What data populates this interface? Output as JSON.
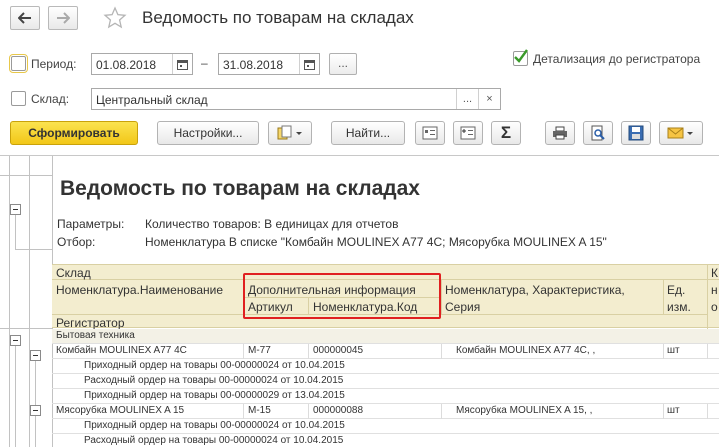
{
  "window": {
    "title": "Ведомость по товарам на складах"
  },
  "form": {
    "period_label": "Период:",
    "period_from": "01.08.2018",
    "period_dash": "–",
    "period_to": "31.08.2018",
    "period_more": "...",
    "detail_label": "Детализация до регистратора",
    "detail_checked": true,
    "warehouse_label": "Склад:",
    "warehouse_value": "Центральный склад",
    "warehouse_select": "...",
    "warehouse_clear": "×"
  },
  "toolbar": {
    "generate_label": "Сформировать",
    "settings_label": "Настройки...",
    "find_label": "Найти...",
    "sum_label": "Σ"
  },
  "report": {
    "title": "Ведомость по товарам на складах",
    "params_label": "Параметры:",
    "params_value": "Количество товаров: В единицах для отчетов",
    "filter_label": "Отбор:",
    "filter_value": "Номенклатура В списке \"Комбайн MOULINEX  A77 4C; Мясорубка MOULINEX  A 15\"",
    "header": {
      "warehouse": "Склад",
      "item_name": "Номенклатура.Наименование",
      "extra_info": "Дополнительная информация",
      "article": "Артикул",
      "item_code": "Номенклатура.Код",
      "item_char": "Номенклатура, Характеристика,",
      "series": "Серия",
      "unit_1": "Ед.",
      "unit_2": "изм.",
      "col_k": "К",
      "col_n": "н",
      "col_o": "о",
      "registrar": "Регистратор"
    },
    "rows": [
      {
        "type": "group",
        "name": "Бытовая техника",
        "article": "",
        "code": "",
        "char": "",
        "unit": ""
      },
      {
        "type": "item",
        "name": "Комбайн MOULINEX  A77 4C",
        "article": "M-77",
        "code": "000000045",
        "char": "Комбайн MOULINEX  A77 4C, ,",
        "unit": "шт"
      },
      {
        "type": "doc",
        "name": "Приходный ордер на товары 00-00000024 от 10.04.2015",
        "article": "",
        "code": "",
        "char": "",
        "unit": ""
      },
      {
        "type": "doc",
        "name": "Расходный ордер на товары 00-00000024 от 10.04.2015",
        "article": "",
        "code": "",
        "char": "",
        "unit": ""
      },
      {
        "type": "doc",
        "name": "Приходный ордер на товары 00-00000029 от 13.04.2015",
        "article": "",
        "code": "",
        "char": "",
        "unit": ""
      },
      {
        "type": "item",
        "name": "Мясорубка MOULINEX  A 15",
        "article": "M-15",
        "code": "000000088",
        "char": "Мясорубка MOULINEX  A 15, ,",
        "unit": "шт"
      },
      {
        "type": "doc",
        "name": "Приходный ордер на товары 00-00000024 от 10.04.2015",
        "article": "",
        "code": "",
        "char": "",
        "unit": ""
      },
      {
        "type": "doc",
        "name": "Расходный ордер на товары 00-00000024 от 10.04.2015",
        "article": "",
        "code": "",
        "char": "",
        "unit": ""
      }
    ]
  },
  "colors": {
    "primary_button": "#f2c718",
    "header_bg": "#f3edcf",
    "highlight_box": "#e02020",
    "check_green": "#3a9a2a"
  }
}
